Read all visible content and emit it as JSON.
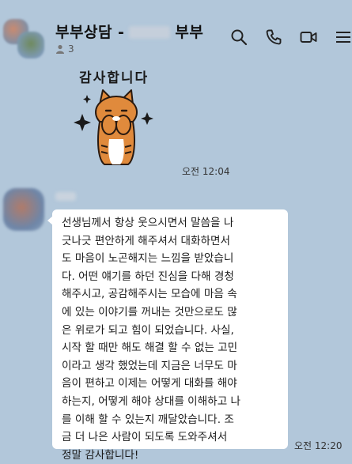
{
  "header": {
    "title_prefix": "부부상담 -",
    "title_suffix": "부부",
    "member_count": "3"
  },
  "icons": [
    "search-icon",
    "call-icon",
    "video-icon",
    "menu-icon",
    "person-icon"
  ],
  "messages": [
    {
      "type": "sticker",
      "sticker_text": "감사합니다",
      "time": "오전 12:04"
    },
    {
      "type": "text",
      "lines": [
        "선생님께서 항상 웃으시면서 말씀을 나",
        "긋나긋 편안하게 해주셔서 대화하면서",
        "도 마음이 노곤해지는 느낌을 받았습니",
        "다. 어떤 얘기를 하던 진심을 다해 경청",
        "해주시고, 공감해주시는 모습에 마음 속",
        "에 있는 이야기를 꺼내는 것만으로도 많",
        "은 위로가 되고 힘이 되었습니다. 사실,",
        "시작 할 때만 해도 해결 할 수 없는 고민",
        "이라고 생각 했었는데 지금은 너무도 마",
        "음이 편하고 이제는 어떻게 대화를 해야",
        "하는지, 어떻게 해야 상대를 이해하고 나",
        "를 이해 할 수 있는지 깨달았습니다. 조",
        "금 더 나은 사람이 되도록 도와주셔서",
        "정말 감사합니다!"
      ],
      "time": "오전 12:20"
    }
  ],
  "colors": {
    "background": "#b2c7da",
    "bubble": "#ffffff",
    "cat_orange": "#e08a3c"
  }
}
